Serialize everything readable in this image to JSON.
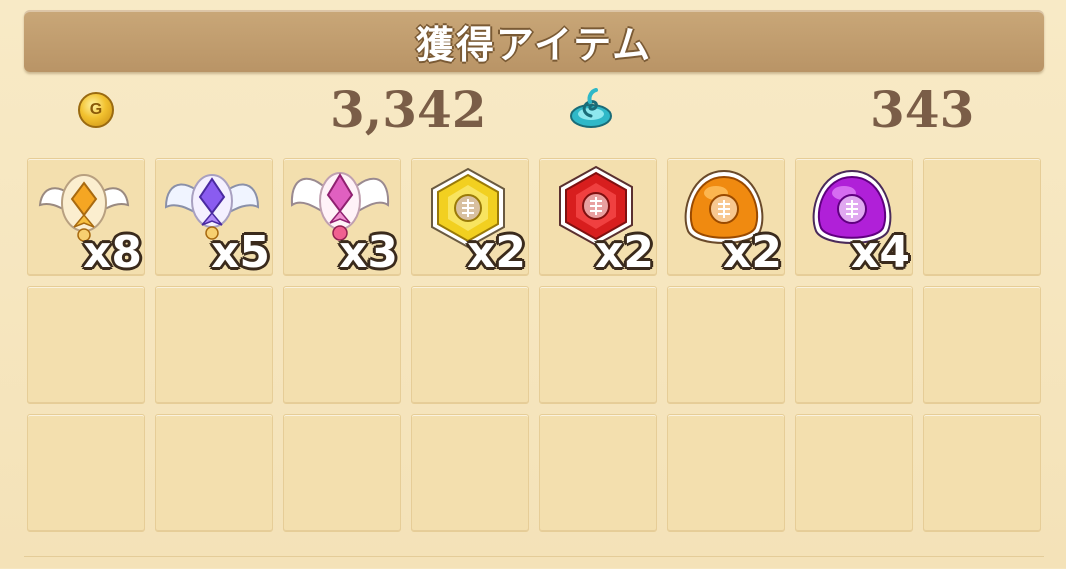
{
  "title": "獲得アイテム",
  "currencies": {
    "gold": {
      "icon": "gold-coin-icon",
      "label": "G",
      "value": "3,342"
    },
    "spirit": {
      "icon": "spirit-swirl-icon",
      "value": "343"
    }
  },
  "items": [
    {
      "name": "orange-winged-emblem",
      "icon": "winged-emblem-orange-icon",
      "quantity": "x8",
      "color": "#f5a623"
    },
    {
      "name": "purple-winged-emblem",
      "icon": "winged-emblem-purple-icon",
      "quantity": "x5",
      "color": "#8a5cf0"
    },
    {
      "name": "pink-winged-emblem",
      "icon": "winged-emblem-pink-icon",
      "quantity": "x3",
      "color": "#e060c0"
    },
    {
      "name": "yellow-hexagon-gem",
      "icon": "yellow-gem-icon",
      "quantity": "x2",
      "color": "#f2d020"
    },
    {
      "name": "red-hexagon-gem",
      "icon": "red-gem-icon",
      "quantity": "x2",
      "color": "#d81e1e"
    },
    {
      "name": "orange-round-gem",
      "icon": "orange-stone-icon",
      "quantity": "x2",
      "color": "#f08a10"
    },
    {
      "name": "purple-round-gem",
      "icon": "purple-stone-icon",
      "quantity": "x4",
      "color": "#b020d8"
    }
  ],
  "total_slots": 24
}
